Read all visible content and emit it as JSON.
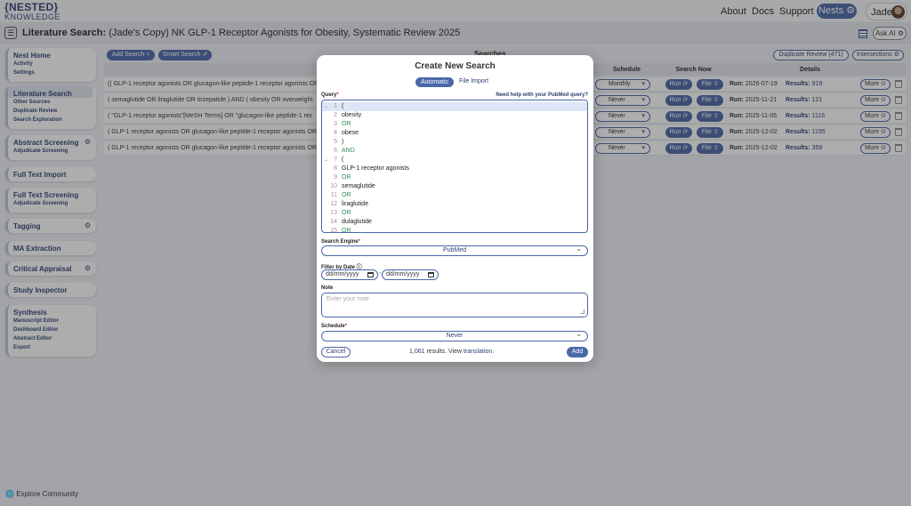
{
  "nav": {
    "logo_line1": "{NESTED}",
    "logo_line2": "KNOWLEDGE",
    "about": "About",
    "docs": "Docs",
    "support": "Support",
    "nests": "Nests ⚙",
    "user": "Jade"
  },
  "titlebar": {
    "prefix": "Literature Search:",
    "title": "(Jade's Copy) NK GLP-1 Receptor Agonists for Obesity, Systematic Review 2025",
    "ask_ai": "Ask AI ⚙"
  },
  "sidebar": {
    "groups": [
      {
        "head": "Nest Home",
        "subs": [
          "Activity",
          "Settings"
        ]
      },
      {
        "head": "Literature Search",
        "subs": [
          "Other Sources",
          "Duplicate Review",
          "Search Exploration"
        ]
      },
      {
        "head": "Abstract Screening",
        "subs": [
          "Adjudicate Screening"
        ]
      },
      {
        "head": "Full Text Import",
        "subs": []
      },
      {
        "head": "Full Text Screening",
        "subs": [
          "Adjudicate Screening"
        ]
      },
      {
        "head": "Tagging",
        "subs": []
      },
      {
        "head": "MA Extraction",
        "subs": []
      },
      {
        "head": "Critical Appraisal",
        "subs": []
      },
      {
        "head": "Study Inspector",
        "subs": []
      },
      {
        "head": "Synthesis",
        "subs": [
          "Manuscript Editor",
          "Dashboard Editor",
          "Abstract Editor",
          "Export"
        ]
      }
    ],
    "explore": "Explore Community"
  },
  "main": {
    "add_search": "Add Search +",
    "smart_search": "Smart Search ⇗",
    "section_title": "Searches",
    "duplicate_review": "Duplicate Review (471)",
    "intersections": "Intersections ⚙",
    "columns": [
      "Query",
      "Schedule",
      "Search Now",
      "Details"
    ],
    "rows": [
      {
        "query": "(( GLP-1 receptor agonists OR glucagon-like peptide-1 receptor agonists OR semaglutide OR liraglutide OR dulaglutide",
        "schedule": "Monthly",
        "run": "Run ⟳",
        "file": "File ⇧",
        "run_label": "Run:",
        "run_date": "2026-07-19",
        "results_label": "Results:",
        "results": "919",
        "more": "More ⊙"
      },
      {
        "query": "( semaglutide OR liraglutide OR tirzepatide ) AND ( obesity OR overweight",
        "schedule": "Never",
        "run": "Run ⟳",
        "file": "File ⇧",
        "run_label": "Run:",
        "run_date": "2025-11-21",
        "results_label": "Results:",
        "results": "121",
        "more": "More ⊙"
      },
      {
        "query": "( \"GLP-1 receptor agonists\"[MeSH Terms] OR \"glucagon-like peptide-1 rec",
        "schedule": "Never",
        "run": "Run ⟳",
        "file": "File ⇧",
        "run_label": "Run:",
        "run_date": "2025-11-05",
        "results_label": "Results:",
        "results": "1116",
        "more": "More ⊙"
      },
      {
        "query": "( GLP-1 receptor agonists OR glucagon-like peptide-1 receptor agonists OR semaglutide",
        "schedule": "Never",
        "run": "Run ⟳",
        "file": "File ⇧",
        "run_label": "Run:",
        "run_date": "2025-12-02",
        "results_label": "Results:",
        "results": "1195",
        "more": "More ⊙"
      },
      {
        "query": "( GLP-1 receptor agonists OR glucagon-like peptide-1 receptor agonists OR semaglutide",
        "schedule": "Never",
        "run": "Run ⟳",
        "file": "File ⇧",
        "run_label": "Run:",
        "run_date": "2025-12-02",
        "results_label": "Results:",
        "results": "358",
        "more": "More ⊙"
      }
    ]
  },
  "modal": {
    "title": "Create New Search",
    "tab_automatic": "Automatic",
    "tab_file_import": "File Import",
    "query_label": "Query",
    "required_mark": "*",
    "help_link": "Need help with your PubMed query?",
    "query_lines": [
      {
        "num": "1",
        "text": "(",
        "type": "plain",
        "fold": "⌄"
      },
      {
        "num": "2",
        "text": "obesity",
        "type": "plain",
        "fold": ""
      },
      {
        "num": "3",
        "text": "OR",
        "type": "op",
        "fold": ""
      },
      {
        "num": "4",
        "text": "obese",
        "type": "plain",
        "fold": ""
      },
      {
        "num": "5",
        "text": ")",
        "type": "plain",
        "fold": ""
      },
      {
        "num": "6",
        "text": "AND",
        "type": "op",
        "fold": ""
      },
      {
        "num": "7",
        "text": "(",
        "type": "plain",
        "fold": "⌄"
      },
      {
        "num": "8",
        "text": "GLP-1 receptor agonists",
        "type": "plain",
        "fold": ""
      },
      {
        "num": "9",
        "text": "OR",
        "type": "op",
        "fold": ""
      },
      {
        "num": "10",
        "text": "semaglutide",
        "type": "plain",
        "fold": ""
      },
      {
        "num": "11",
        "text": "OR",
        "type": "op",
        "fold": ""
      },
      {
        "num": "12",
        "text": "liraglutide",
        "type": "plain",
        "fold": ""
      },
      {
        "num": "13",
        "text": "OR",
        "type": "op",
        "fold": ""
      },
      {
        "num": "14",
        "text": "dulaglutide",
        "type": "plain",
        "fold": ""
      },
      {
        "num": "15",
        "text": "OR",
        "type": "op",
        "fold": ""
      }
    ],
    "engine_label": "Search Engine",
    "engine_value": "PubMed",
    "filter_label": "Filter by Date ⓘ",
    "date_placeholder_from": "dd/mm/yyyy",
    "date_placeholder_to": "dd/mm/yyyy",
    "date_dash": "-",
    "note_label": "Note",
    "note_placeholder": "Enter your note",
    "schedule_label": "Schedule",
    "schedule_value": "Never",
    "cancel": "Cancel",
    "results_count": "1,061",
    "results_text": " results.  View ",
    "translation_link": "translation.",
    "add": "Add"
  },
  "colors": {
    "accent": "#4a67a8",
    "brand_dark": "#2b3f73",
    "operator_green": "#2e8b57",
    "background": "#eef0f5"
  }
}
